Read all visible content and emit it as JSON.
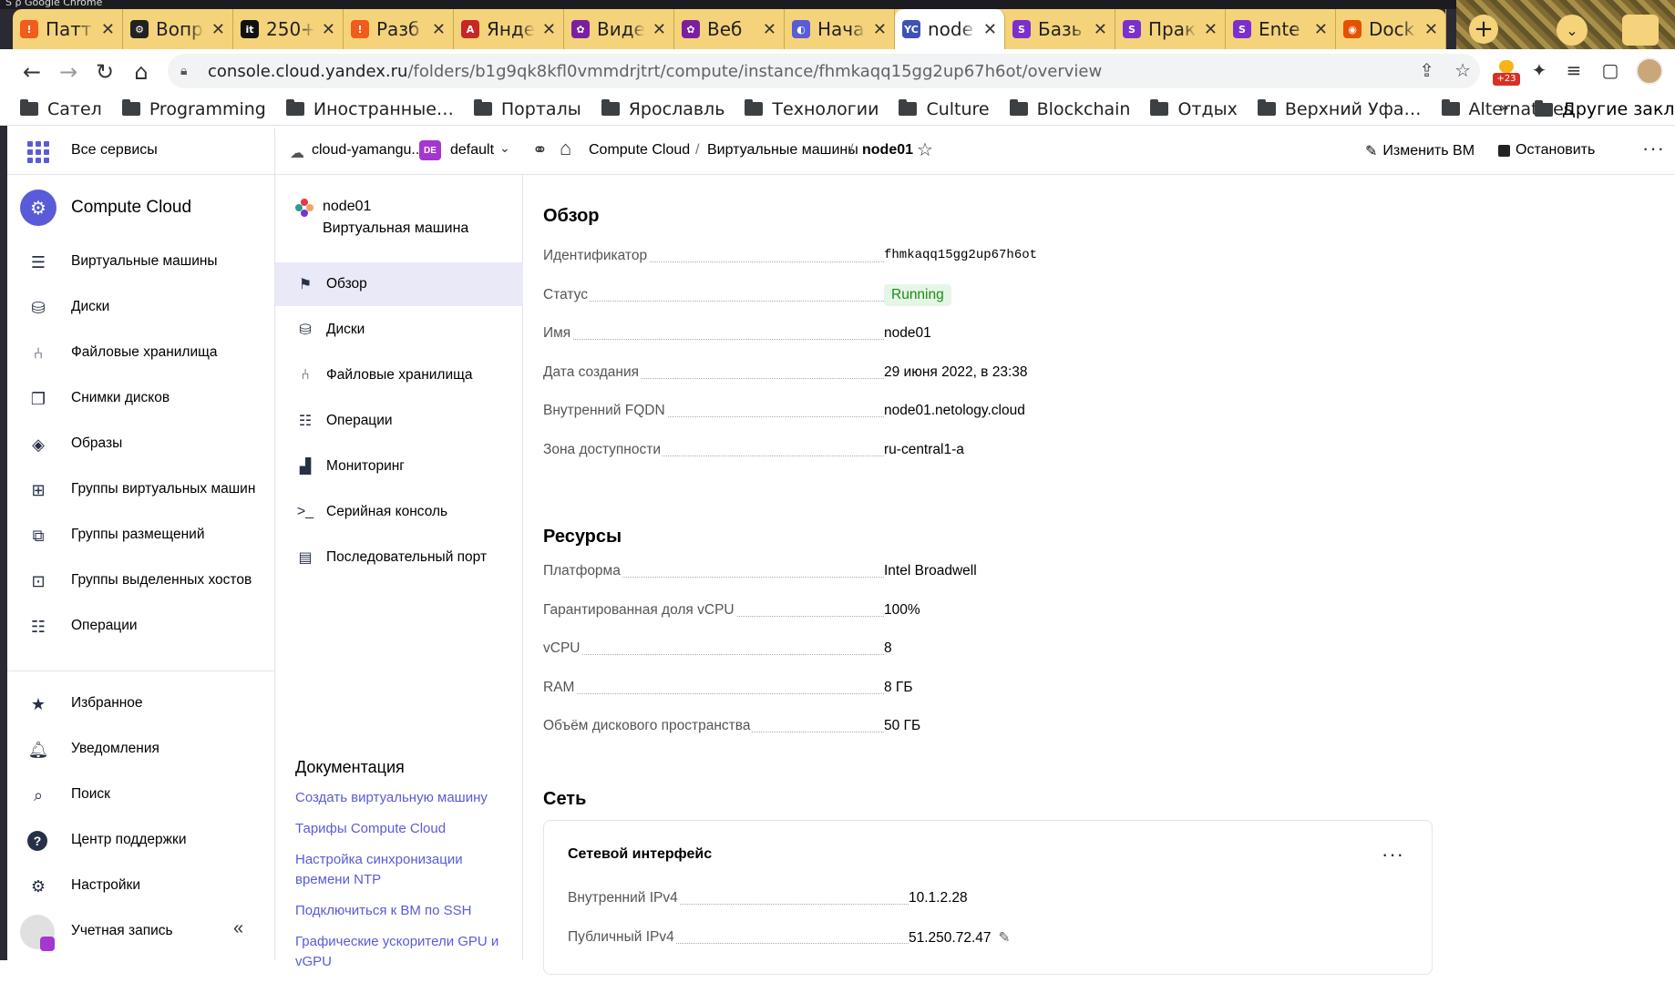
{
  "browser": {
    "top_caption": "Ṡ ρ  Google Chrome",
    "tabs": [
      {
        "title": "Патт",
        "fav_color": "#f25b1c",
        "glyph": "!"
      },
      {
        "title": "Вопр",
        "fav_color": "#222222",
        "glyph": "⚙"
      },
      {
        "title": "250+",
        "fav_color": "#111111",
        "glyph": "it"
      },
      {
        "title": "Разб",
        "fav_color": "#f25b1c",
        "glyph": "!"
      },
      {
        "title": "Янде",
        "fav_color": "#c62828",
        "glyph": "A"
      },
      {
        "title": "Виде",
        "fav_color": "#7b1fa2",
        "glyph": "✿"
      },
      {
        "title": "Веб",
        "fav_color": "#7b1fa2",
        "glyph": "✿"
      },
      {
        "title": "Нача",
        "fav_color": "#5a5bd8",
        "glyph": "◐"
      },
      {
        "title": "node",
        "fav_color": "#3f51b5",
        "glyph": "YC"
      },
      {
        "title": "Базь",
        "fav_color": "#7b2fd0",
        "glyph": "S"
      },
      {
        "title": "Прак",
        "fav_color": "#7b2fd0",
        "glyph": "S"
      },
      {
        "title": "Ente",
        "fav_color": "#7b2fd0",
        "glyph": "S"
      },
      {
        "title": "Dock",
        "fav_color": "#e65100",
        "glyph": "◉"
      }
    ],
    "active_tab_index": 8,
    "close_glyph": "✕",
    "new_tab_glyph": "+",
    "tab_menu_glyph": "⌄",
    "url_host": "console.cloud.yandex.ru",
    "url_path": "/folders/b1g9qk8kfl0vmmdrjtrt/compute/instance/fhmkaqq15gg2up67h6ot/overview",
    "ext_badge": "+23",
    "bookmarks": [
      "Сател",
      "Programming",
      "Иностранные…",
      "Порталы",
      "Ярославль",
      "Технологии",
      "Culture",
      "Blockchain",
      "Отдых",
      "Верхний Уфа…",
      "Alternatives"
    ],
    "bookmarks_more": "»",
    "bookmarks_other": "Другие заклад"
  },
  "nav": {
    "all_services": "Все сервисы",
    "service_title": "Compute Cloud",
    "items": [
      {
        "label": "Виртуальные машины",
        "icon": "server-icon"
      },
      {
        "label": "Диски",
        "icon": "disk-icon"
      },
      {
        "label": "Файловые хранилища",
        "icon": "file-storage-icon"
      },
      {
        "label": "Снимки дисков",
        "icon": "snapshot-icon"
      },
      {
        "label": "Образы",
        "icon": "image-layers-icon"
      },
      {
        "label": "Группы виртуальных машин",
        "icon": "instance-group-icon"
      },
      {
        "label": "Группы размещений",
        "icon": "placement-group-icon"
      },
      {
        "label": "Группы выделенных хостов",
        "icon": "host-group-icon"
      },
      {
        "label": "Операции",
        "icon": "operations-icon"
      }
    ],
    "bottom_items": [
      {
        "label": "Избранное",
        "icon": "star-icon"
      },
      {
        "label": "Уведомления",
        "icon": "bell-icon"
      },
      {
        "label": "Поиск",
        "icon": "search-icon"
      },
      {
        "label": "Центр поддержки",
        "icon": "help-icon"
      },
      {
        "label": "Настройки",
        "icon": "gear-icon"
      },
      {
        "label": "Учетная запись",
        "icon": "account-icon"
      }
    ],
    "collapse_glyph": "«"
  },
  "header": {
    "cloud": "cloud-yamangu...",
    "folder_badge": "DE",
    "folder": "default",
    "breadcrumbs": [
      "Compute Cloud",
      "Виртуальные машины",
      "node01"
    ],
    "separator": "/",
    "edit_label": "Изменить ВМ",
    "stop_label": "Остановить",
    "more_glyph": "···"
  },
  "subnav": {
    "vm_name": "node01",
    "vm_type": "Виртуальная машина",
    "items": [
      {
        "label": "Обзор",
        "icon": "overview-flag-icon",
        "active": true
      },
      {
        "label": "Диски",
        "icon": "disk-icon",
        "active": false
      },
      {
        "label": "Файловые хранилища",
        "icon": "file-storage-icon",
        "active": false
      },
      {
        "label": "Операции",
        "icon": "operations-icon",
        "active": false
      },
      {
        "label": "Мониторинг",
        "icon": "monitoring-chart-icon",
        "active": false
      },
      {
        "label": "Серийная консоль",
        "icon": "terminal-icon",
        "active": false
      },
      {
        "label": "Последовательный порт",
        "icon": "document-icon",
        "active": false
      }
    ],
    "docs_title": "Документация",
    "docs_links": [
      "Создать виртуальную машину",
      "Тарифы Compute Cloud",
      "Настройка синхронизации времени NTP",
      "Подключиться к ВМ по SSH",
      "Графические ускорители GPU и vGPU"
    ]
  },
  "overview": {
    "title": "Обзор",
    "fields": [
      {
        "key": "Идентификатор",
        "value": "fhmkaqq15gg2up67h6ot",
        "mono": true
      },
      {
        "key": "Статус",
        "value": "Running",
        "status": true
      },
      {
        "key": "Имя",
        "value": "node01"
      },
      {
        "key": "Дата создания",
        "value": "29 июня 2022, в 23:38"
      },
      {
        "key": "Внутренний FQDN",
        "value": "node01.netology.cloud"
      },
      {
        "key": "Зона доступности",
        "value": "ru-central1-a"
      }
    ]
  },
  "resources": {
    "title": "Ресурсы",
    "fields": [
      {
        "key": "Платформа",
        "value": "Intel Broadwell"
      },
      {
        "key": "Гарантированная доля vCPU",
        "value": "100%"
      },
      {
        "key": "vCPU",
        "value": "8"
      },
      {
        "key": "RAM",
        "value": "8 ГБ"
      },
      {
        "key": "Объём дискового пространства",
        "value": "50 ГБ"
      }
    ]
  },
  "network": {
    "title": "Сеть",
    "card_title": "Сетевой интерфейс",
    "menu_glyph": "···",
    "fields": [
      {
        "key": "Внутренний IPv4",
        "value": "10.1.2.28"
      },
      {
        "key": "Публичный IPv4",
        "value": "51.250.72.47",
        "editable": true
      }
    ]
  },
  "colors": {
    "accent": "#5a5bd8",
    "status_running": "#1a8c1a",
    "status_bg": "#e6f6e6",
    "active_item_bg": "#e9e9f8"
  }
}
